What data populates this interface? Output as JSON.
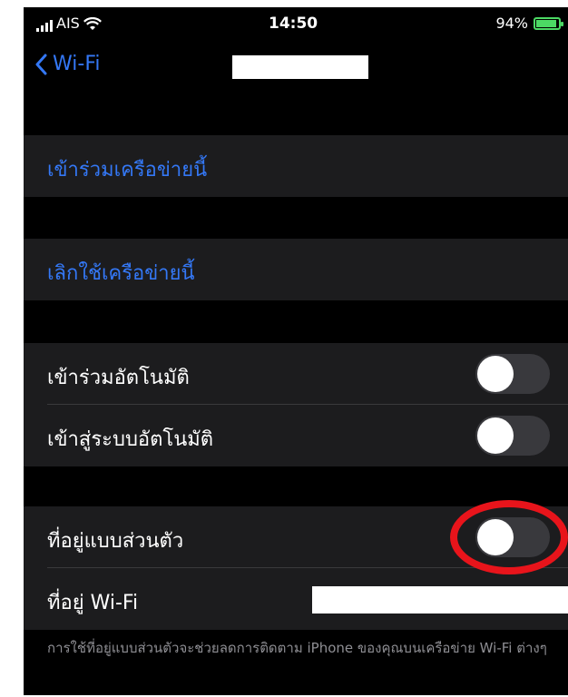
{
  "status": {
    "carrier": "AIS",
    "time": "14:50",
    "battery": "94%",
    "battery_icon": "battery-charging-icon",
    "signal_icon": "cellular-signal-icon",
    "wifi_icon": "wifi-icon"
  },
  "nav": {
    "back_label": "Wi-Fi",
    "back_icon": "chevron-left-icon"
  },
  "actions": {
    "join": "เข้าร่วมเครือข่ายนี้",
    "forget": "เลิกใช้เครือข่ายนี้"
  },
  "auto": {
    "auto_join": "เข้าร่วมอัตโนมัติ",
    "auto_join_on": false,
    "auto_login": "เข้าสู่ระบบอัตโนมัติ",
    "auto_login_on": false
  },
  "privacy": {
    "private_address": "ที่อยู่แบบส่วนตัว",
    "private_address_on": false,
    "wifi_address": "ที่อยู่ Wi-Fi",
    "footer": "การใช้ที่อยู่แบบส่วนตัวจะช่วยลดการติดตาม iPhone ของคุณบนเครือข่าย Wi-Fi ต่างๆ"
  },
  "colors": {
    "accent": "#3478f6",
    "highlight_ring": "#e8141b",
    "cell_bg": "#1c1c1e"
  }
}
